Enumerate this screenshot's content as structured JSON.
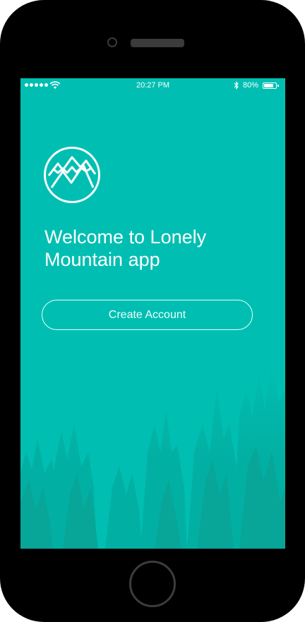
{
  "statusbar": {
    "time": "20:27 PM",
    "battery_percent": "80%",
    "battery_level": 0.8
  },
  "welcome": {
    "headline": "Welcome to Lonely Mountain app"
  },
  "actions": {
    "create_account_label": "Create Account"
  },
  "icons": [
    "signal-dots-icon",
    "wifi-icon",
    "bluetooth-icon",
    "battery-icon",
    "mountain-logo-icon"
  ],
  "colors": {
    "screen_background": "#00bfb2",
    "phone_frame": "#000000",
    "text": "#ffffff"
  }
}
